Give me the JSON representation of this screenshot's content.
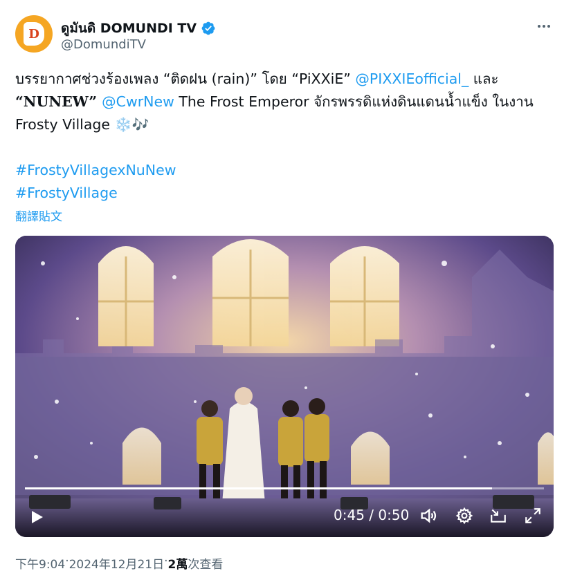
{
  "author": {
    "display_name": "ดูมันดิ DOMUNDI TV",
    "handle": "@DomundiTV",
    "avatar_text": "D",
    "verified": true
  },
  "tweet": {
    "line1": {
      "text": "บรรยากาศช่วงร้องเพลง “ติดฝน (rain)” โดย “PiXXiE” ",
      "mention": "@PIXXIEofficial_",
      "after": " และ"
    },
    "line2": {
      "quote_open": "“",
      "bold": "NUNEW",
      "quote_close": "” ",
      "mention": "@CwrNew",
      "after": " The Frost Emperor จักรพรรดิแห่งดินแดนน้ำแข็ง ในงาน"
    },
    "line3": {
      "text": "Frosty Village ",
      "emojis": "❄️🎶"
    },
    "hashtags": [
      "#FrostyVillagexNuNew",
      "#FrostyVillage"
    ],
    "translate_label": "翻譯貼文"
  },
  "video": {
    "current_time": "0:45",
    "separator": " / ",
    "duration": "0:50",
    "progress": 0.9
  },
  "meta": {
    "time": "下午9:04",
    "dot1": " · ",
    "date": "2024年12月21日",
    "dot2": " · ",
    "views_count": "2萬",
    "views_label": " 次查看"
  },
  "colors": {
    "link": "#1d9bf0",
    "secondary": "#536471",
    "avatar_bg": "#f5a623"
  },
  "icons": [
    "verified-badge-icon",
    "more-icon",
    "play-icon",
    "volume-icon",
    "settings-icon",
    "pip-icon",
    "fullscreen-icon"
  ]
}
